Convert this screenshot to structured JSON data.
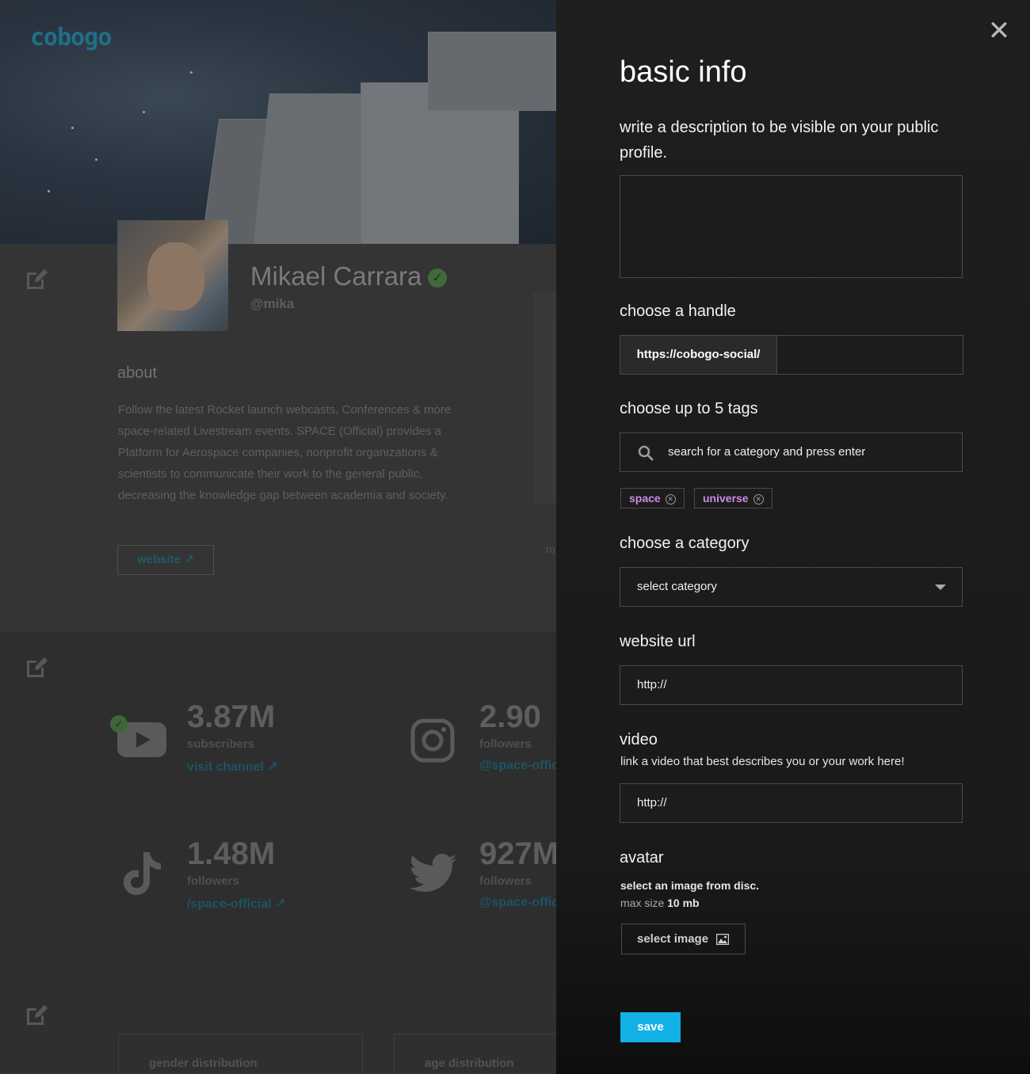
{
  "background": {
    "logo": "cobogo",
    "profile": {
      "name": "Mikael Carrara",
      "handle": "@mika",
      "about_heading": "about",
      "about_text": "Follow the latest Rocket launch webcasts, Conferences & more space-related Livestream events. SPACE (Official) provides a Platform for Aerospace companies, nonprofit organizations & scientists to communicate their work to the general public, decreasing the knowledge gap between academia and society.",
      "website_label": "website",
      "partial_label": "ro"
    },
    "stats": [
      {
        "platform": "youtube",
        "value": "3.87M",
        "label": "subscribers",
        "link": "visit channel"
      },
      {
        "platform": "instagram",
        "value": "2.90",
        "label": "followers",
        "link": "@space-offic"
      },
      {
        "platform": "tiktok",
        "value": "1.48M",
        "label": "followers",
        "link": "/space-official"
      },
      {
        "platform": "twitter",
        "value": "927M",
        "label": "followers",
        "link": "@space-offic"
      }
    ],
    "distribution": {
      "gender": "gender distribution",
      "age": "age distribution"
    }
  },
  "drawer": {
    "title": "basic info",
    "description_prompt": "write a description to be visible on your public profile.",
    "description_value": "",
    "handle": {
      "label": "choose a handle",
      "prefix": "https://cobogo-social/",
      "value": ""
    },
    "tags": {
      "label": "choose up to 5 tags",
      "placeholder": "search for a category and press enter",
      "items": [
        "space",
        "universe"
      ]
    },
    "category": {
      "label": "choose a category",
      "selected": "select category"
    },
    "website": {
      "label": "website url",
      "value": "http://"
    },
    "video": {
      "label": "video",
      "hint": "link a video that best describes you or your work here!",
      "value": "http://"
    },
    "avatar": {
      "label": "avatar",
      "hint": "select an image from disc.",
      "max_size_prefix": "max size",
      "max_size_value": "10 mb",
      "button": "select image"
    },
    "save": "save",
    "colors": {
      "accent": "#12b1e6",
      "tag_text": "#c98be6"
    }
  }
}
